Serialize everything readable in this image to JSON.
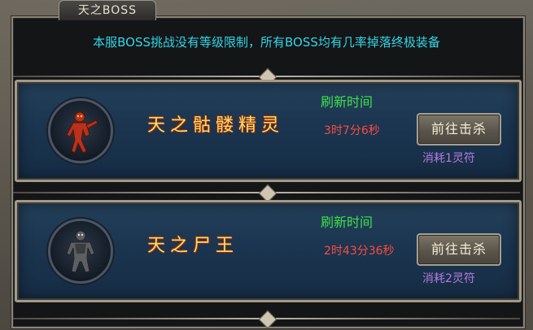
{
  "tab": {
    "title": "天之BOSS"
  },
  "notice": "本服BOSS挑战没有等级限制，所有BOSS均有几率掉落终极装备",
  "bosses": [
    {
      "name": "天之骷髅精灵",
      "refresh_label": "刷新时间",
      "timer": "3时7分6秒",
      "button": "前往击杀",
      "cost": "消耗1灵符",
      "avatar_icon": "skeleton-spirit-icon"
    },
    {
      "name": "天之尸王",
      "refresh_label": "刷新时间",
      "timer": "2时43分36秒",
      "button": "前往击杀",
      "cost": "消耗2灵符",
      "avatar_icon": "corpse-king-icon"
    }
  ],
  "colors": {
    "notice": "#33d6e6",
    "refresh": "#3ee04a",
    "timer": "#ff4a3d",
    "cost": "#b37be0",
    "name": "#f4e06a"
  }
}
